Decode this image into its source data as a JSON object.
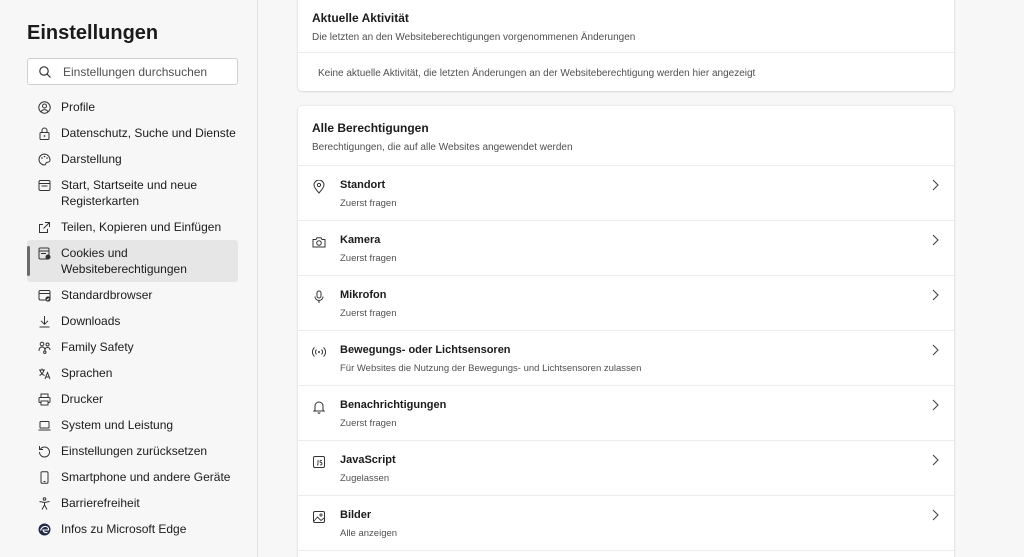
{
  "sidebar": {
    "title": "Einstellungen",
    "search_placeholder": "Einstellungen durchsuchen",
    "items": [
      {
        "label": "Profile",
        "icon": "profile-icon"
      },
      {
        "label": "Datenschutz, Suche und Dienste",
        "icon": "lock-icon"
      },
      {
        "label": "Darstellung",
        "icon": "palette-icon"
      },
      {
        "label": "Start, Startseite und neue Registerkarten",
        "icon": "startpage-icon"
      },
      {
        "label": "Teilen, Kopieren und Einfügen",
        "icon": "share-icon"
      },
      {
        "label": "Cookies und Websiteberechtigungen",
        "icon": "cookies-icon",
        "active": true
      },
      {
        "label": "Standardbrowser",
        "icon": "default-browser-icon"
      },
      {
        "label": "Downloads",
        "icon": "download-icon"
      },
      {
        "label": "Family Safety",
        "icon": "family-icon"
      },
      {
        "label": "Sprachen",
        "icon": "language-icon"
      },
      {
        "label": "Drucker",
        "icon": "printer-icon"
      },
      {
        "label": "System und Leistung",
        "icon": "laptop-icon"
      },
      {
        "label": "Einstellungen zurücksetzen",
        "icon": "reset-icon"
      },
      {
        "label": "Smartphone und andere Geräte",
        "icon": "phone-icon"
      },
      {
        "label": "Barrierefreiheit",
        "icon": "accessibility-icon"
      },
      {
        "label": "Infos zu Microsoft Edge",
        "icon": "edge-icon"
      }
    ]
  },
  "recent_activity": {
    "title": "Aktuelle Aktivität",
    "subtitle": "Die letzten an den Websiteberechtigungen vorgenommenen Änderungen",
    "empty_text": "Keine aktuelle Aktivität, die letzten Änderungen an der Websiteberechtigung werden hier angezeigt"
  },
  "all_permissions": {
    "title": "Alle Berechtigungen",
    "subtitle": "Berechtigungen, die auf alle Websites angewendet werden",
    "items": [
      {
        "title": "Standort",
        "status": "Zuerst fragen",
        "icon": "location-icon"
      },
      {
        "title": "Kamera",
        "status": "Zuerst fragen",
        "icon": "camera-icon"
      },
      {
        "title": "Mikrofon",
        "status": "Zuerst fragen",
        "icon": "microphone-icon"
      },
      {
        "title": "Bewegungs- oder Lichtsensoren",
        "status": "Für Websites die Nutzung der Bewegungs- und Lichtsensoren zulassen",
        "icon": "sensor-icon"
      },
      {
        "title": "Benachrichtigungen",
        "status": "Zuerst fragen",
        "icon": "bell-icon"
      },
      {
        "title": "JavaScript",
        "status": "Zugelassen",
        "icon": "javascript-icon"
      },
      {
        "title": "Bilder",
        "status": "Alle anzeigen",
        "icon": "image-icon"
      }
    ]
  }
}
